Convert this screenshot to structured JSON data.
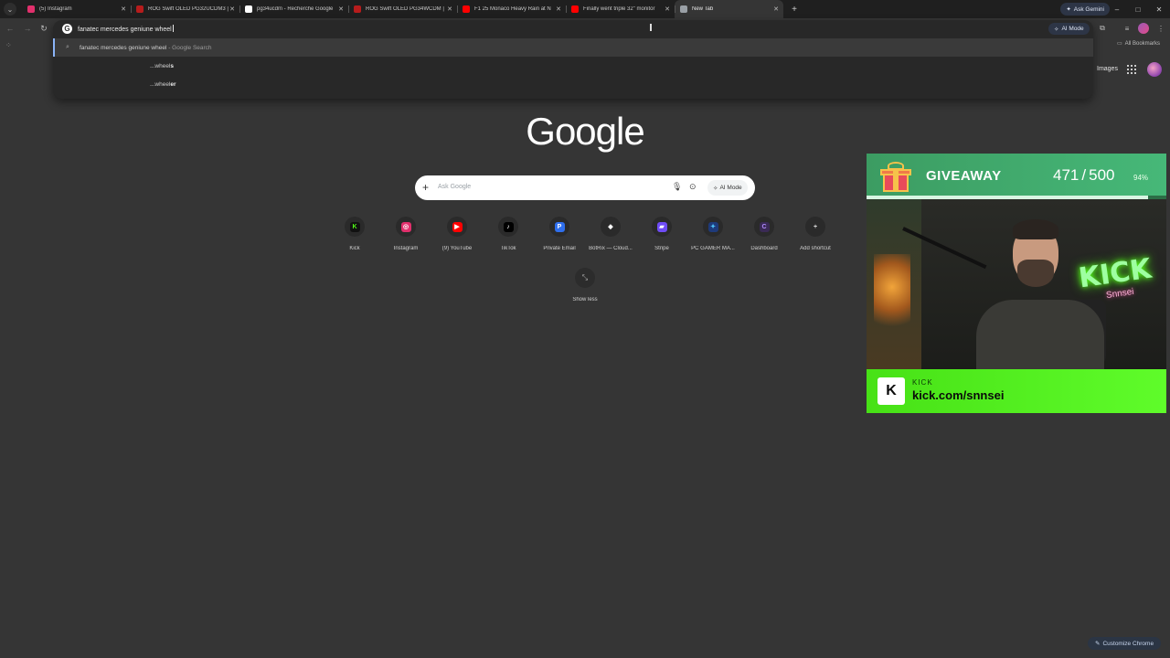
{
  "tabs": [
    {
      "title": "(5) Instagram",
      "color": "#e1306c"
    },
    {
      "title": "ROG Swift OLED PG32UCDM3 |",
      "color": "#b71c1c"
    },
    {
      "title": "pg34ucdm - Recherche Google",
      "color": "#ffffff"
    },
    {
      "title": "ROG Swift OLED PG34WCDM |",
      "color": "#b71c1c"
    },
    {
      "title": "F1 25 Monaco Heavy Rain at N",
      "color": "#ff0000"
    },
    {
      "title": "Finally went triple 32\" monitor",
      "color": "#ff0000"
    },
    {
      "title": "New Tab",
      "color": "#9aa0a6",
      "active": true
    }
  ],
  "browser": {
    "ask_gemini": "Ask Gemini",
    "ai_mode": "AI Mode",
    "all_bookmarks": "All Bookmarks",
    "new_tab_symbol": "+",
    "win_min": "–",
    "win_max": "□",
    "win_close": "✕"
  },
  "omnibox": {
    "typed": "fanatec mercedes geniune wheel",
    "suggestions": [
      {
        "main": "fanatec mercedes geniune wheel",
        "sub": " - Google Search"
      },
      {
        "prefix": "...",
        "main": "wheel",
        "bold": "s"
      },
      {
        "prefix": "...",
        "main": "wheel",
        "bold": "er"
      }
    ]
  },
  "ntp": {
    "images_link": "Images",
    "logo": "Google",
    "search_placeholder": "Ask Google",
    "ai_mode_button": "AI Mode",
    "shortcuts": [
      {
        "label": "Kick",
        "glyph": "K",
        "bg": "#111111",
        "fg": "#53fc18"
      },
      {
        "label": "Instagram",
        "glyph": "◎",
        "bg": "#e1306c",
        "fg": "#ffffff"
      },
      {
        "label": "(9) YouTube",
        "glyph": "▶",
        "bg": "#ff0000",
        "fg": "#ffffff"
      },
      {
        "label": "TikTok",
        "glyph": "♪",
        "bg": "#000000",
        "fg": "#ffffff"
      },
      {
        "label": "Private Email",
        "glyph": "P",
        "bg": "#2f6fed",
        "fg": "#ffffff"
      },
      {
        "label": "BotRix — Cloud...",
        "glyph": "◆",
        "bg": "#2a2a2a",
        "fg": "#ffffff"
      },
      {
        "label": "Stripe",
        "glyph": "▰",
        "bg": "#6f4cf6",
        "fg": "#ffffff"
      },
      {
        "label": "PC GAMER MA...",
        "glyph": "✦",
        "bg": "#1e3a7a",
        "fg": "#4fc3f7"
      },
      {
        "label": "Dashboard",
        "glyph": "C",
        "bg": "#3a2a55",
        "fg": "#b38cff"
      },
      {
        "label": "Add shortcut",
        "glyph": "+",
        "bg": "#2a2a2a",
        "fg": "#e0e0e0"
      }
    ],
    "show_less": "Show less",
    "customize": "Customize Chrome"
  },
  "overlay": {
    "giveaway_title": "GIVEAWAY",
    "count_current": "471",
    "count_sep": "/",
    "count_total": "500",
    "percent": "94%",
    "progress": 0.94,
    "neon_text": "KICK",
    "neon_sub": "Snnsei",
    "kick_label": "KICK",
    "kick_url": "kick.com/snnsei",
    "kick_logo": "K"
  }
}
